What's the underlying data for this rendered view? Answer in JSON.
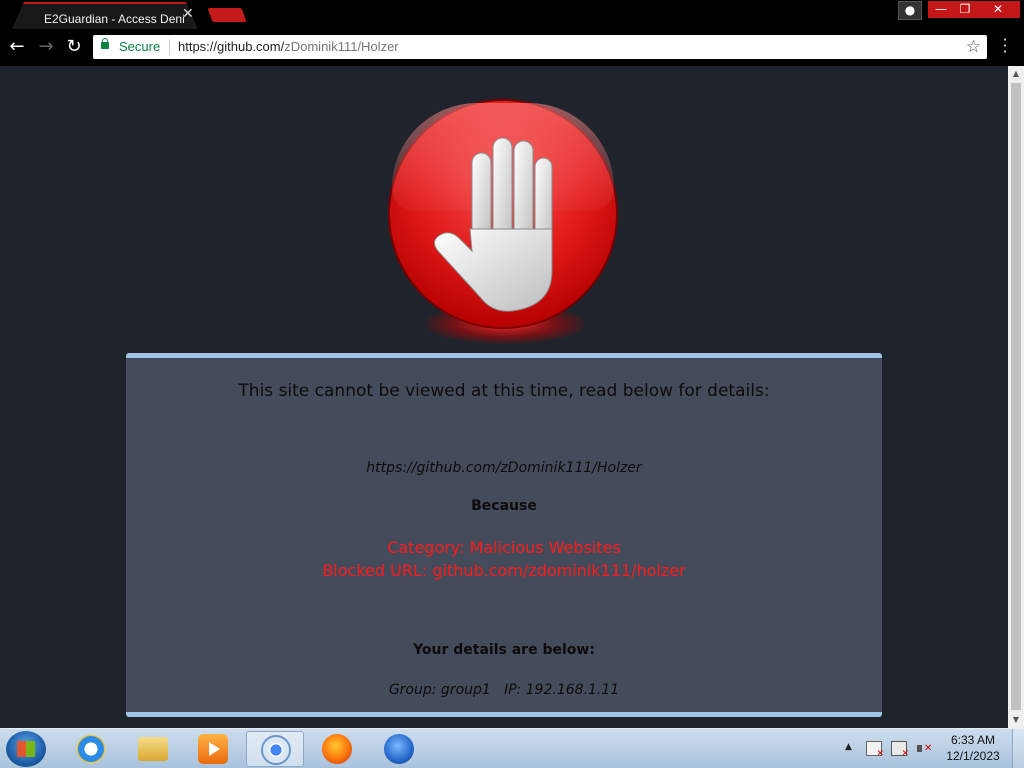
{
  "browser": {
    "tab_title": "E2Guardian - Access Denied",
    "tab_close": "✕",
    "address": {
      "secure_label": "Secure",
      "url_host": "https://github.com/",
      "url_path": "zDominik111/Holzer"
    }
  },
  "page": {
    "headline": "This site cannot be viewed at this time, read below for details:",
    "blocked_url": "https://github.com/zDominik111/Holzer",
    "because": "Because",
    "category": "Category: Malicious Websites",
    "blocked_reason": "Blocked URL: github.com/zdominik111/holzer",
    "details_heading": "Your details are below:",
    "details_line": "Group: group1   IP: 192.168.1.11"
  },
  "taskbar": {
    "clock_time": "6:33 AM",
    "clock_date": "12/1/2023"
  },
  "colors": {
    "stop_red": "#e21b1b",
    "panel_bg": "#444b5b",
    "panel_border": "#9fc5e8",
    "alert_text": "#ff1a1a",
    "secure_green": "#0b8043"
  },
  "icons": [
    "hand-stop-icon",
    "lock-icon",
    "star-icon",
    "back-icon",
    "forward-icon",
    "reload-icon",
    "menu-icon"
  ]
}
